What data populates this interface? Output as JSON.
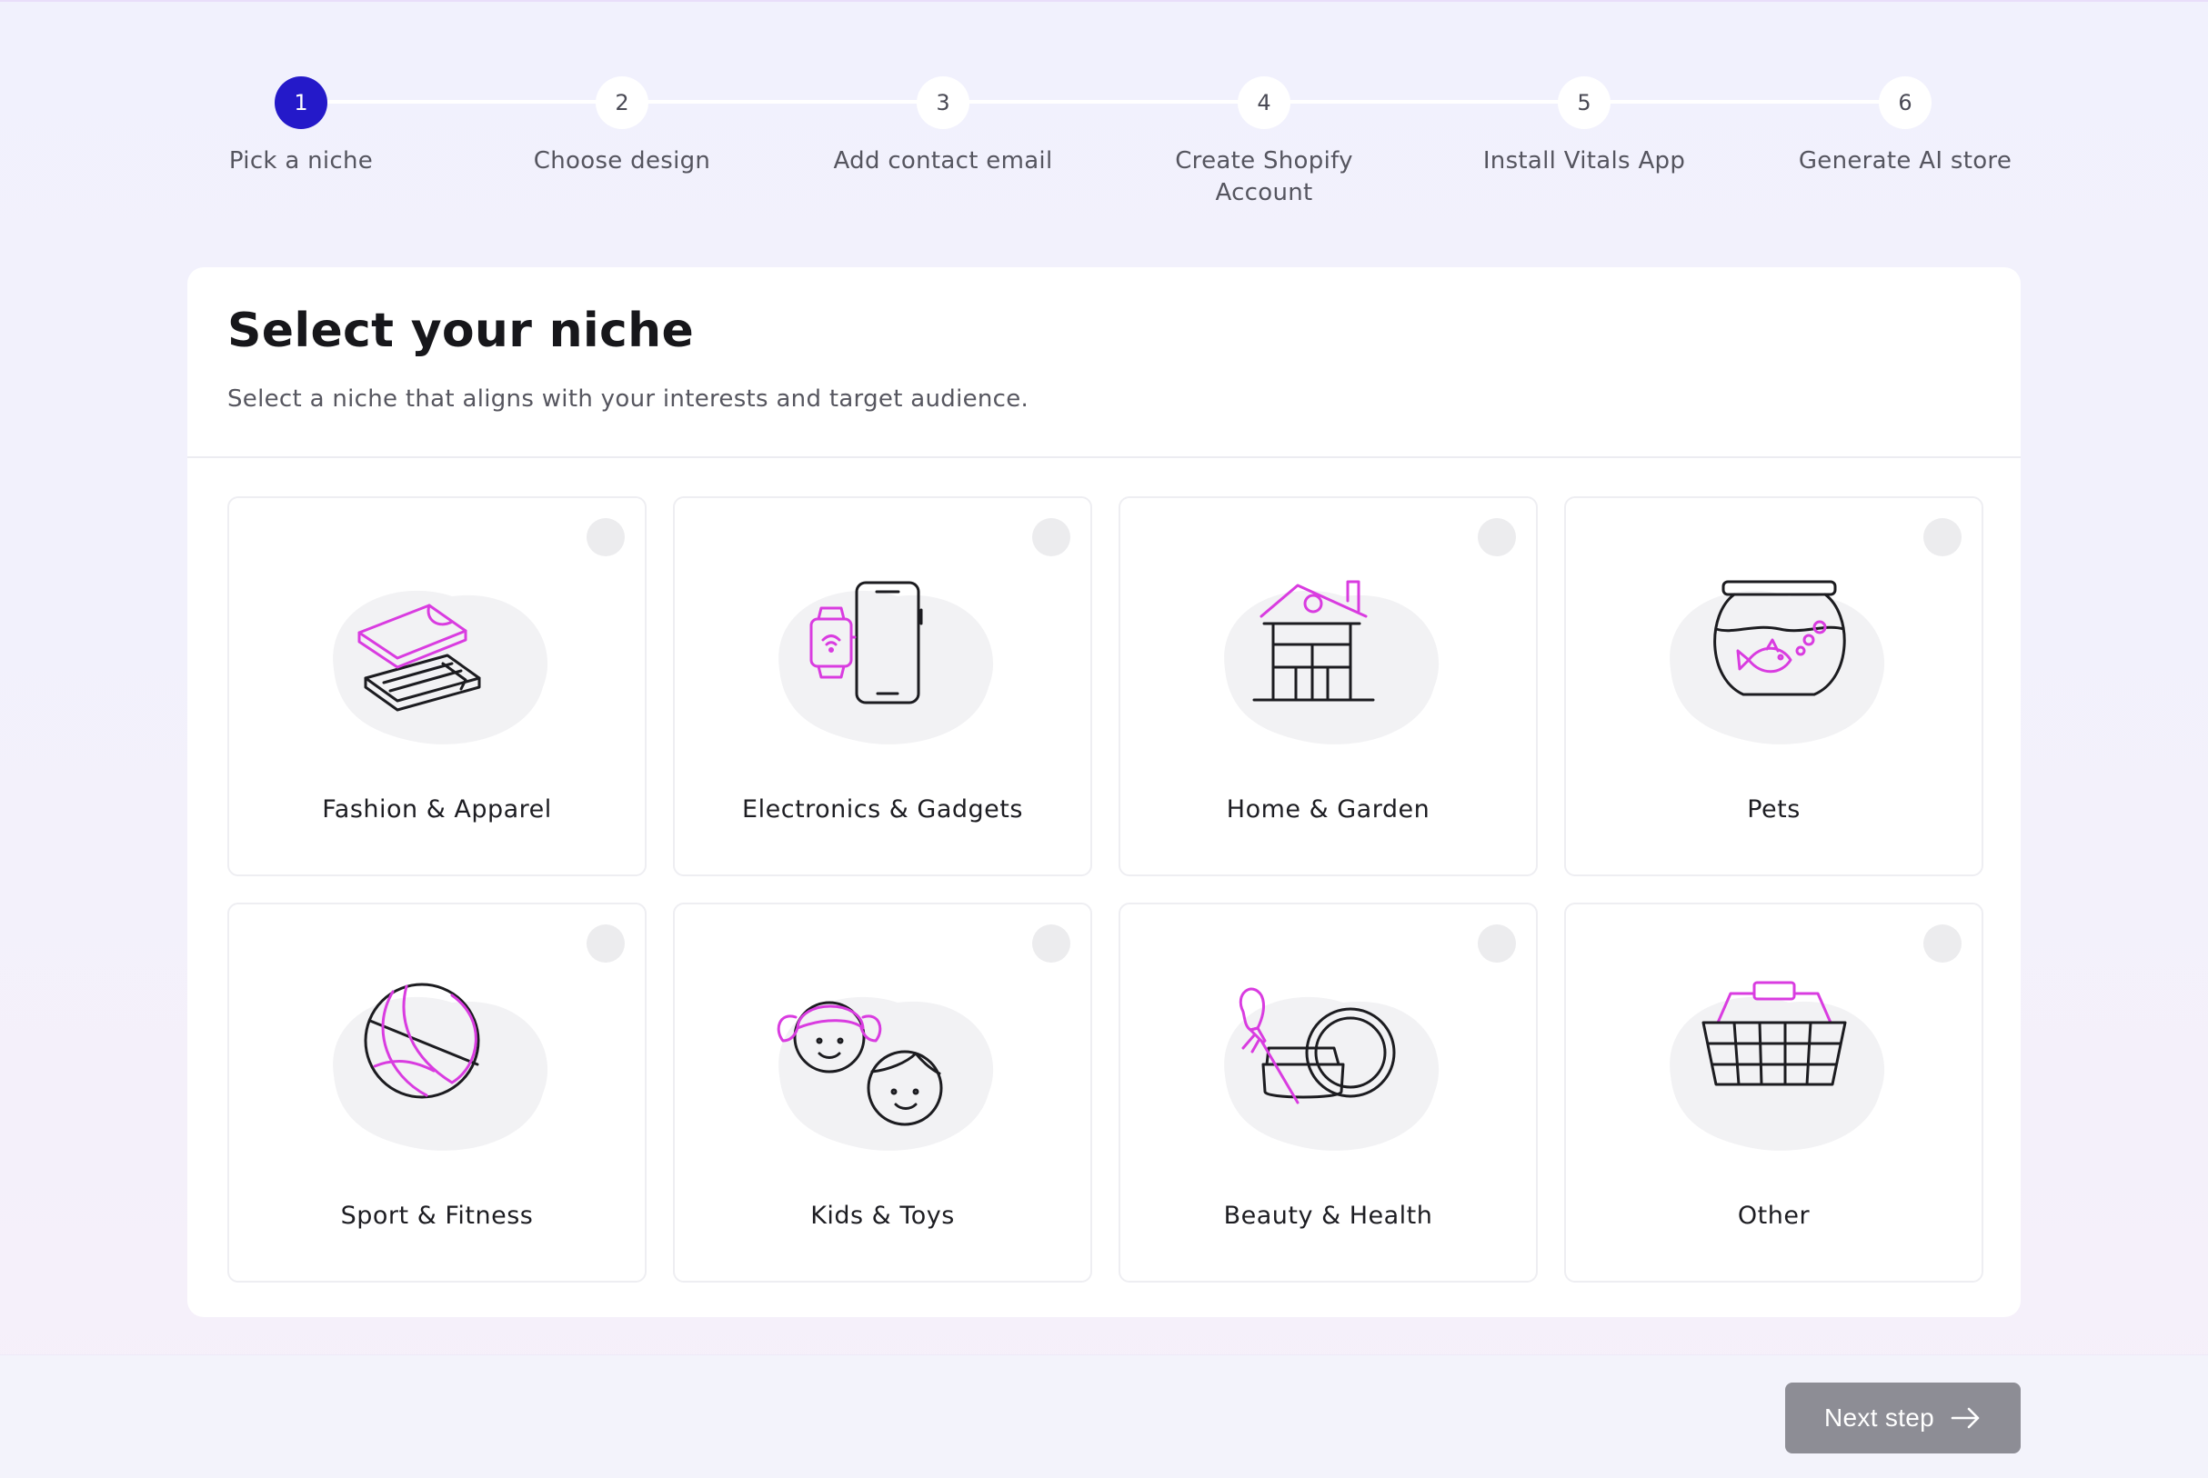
{
  "stepper": {
    "steps": [
      {
        "number": "1",
        "label": "Pick a niche",
        "active": true
      },
      {
        "number": "2",
        "label": "Choose design",
        "active": false
      },
      {
        "number": "3",
        "label": "Add contact email",
        "active": false
      },
      {
        "number": "4",
        "label": "Create Shopify Account",
        "active": false
      },
      {
        "number": "5",
        "label": "Install Vitals App",
        "active": false
      },
      {
        "number": "6",
        "label": "Generate AI store",
        "active": false
      }
    ]
  },
  "card": {
    "title": "Select your niche",
    "subtitle": "Select a niche that aligns with your interests and target audience."
  },
  "niches": [
    {
      "label": "Fashion & Apparel",
      "icon": "wallet-icon"
    },
    {
      "label": "Electronics & Gadgets",
      "icon": "phone-watch-icon"
    },
    {
      "label": "Home & Garden",
      "icon": "house-icon"
    },
    {
      "label": "Pets",
      "icon": "fishbowl-icon"
    },
    {
      "label": "Sport & Fitness",
      "icon": "ball-icon"
    },
    {
      "label": "Kids & Toys",
      "icon": "kids-icon"
    },
    {
      "label": "Beauty & Health",
      "icon": "cosmetics-icon"
    },
    {
      "label": "Other",
      "icon": "basket-icon"
    }
  ],
  "footer": {
    "next_label": "Next step"
  },
  "colors": {
    "accent": "#2419c9",
    "icon_pink": "#d93ce0",
    "button_disabled": "#8d8d95"
  }
}
